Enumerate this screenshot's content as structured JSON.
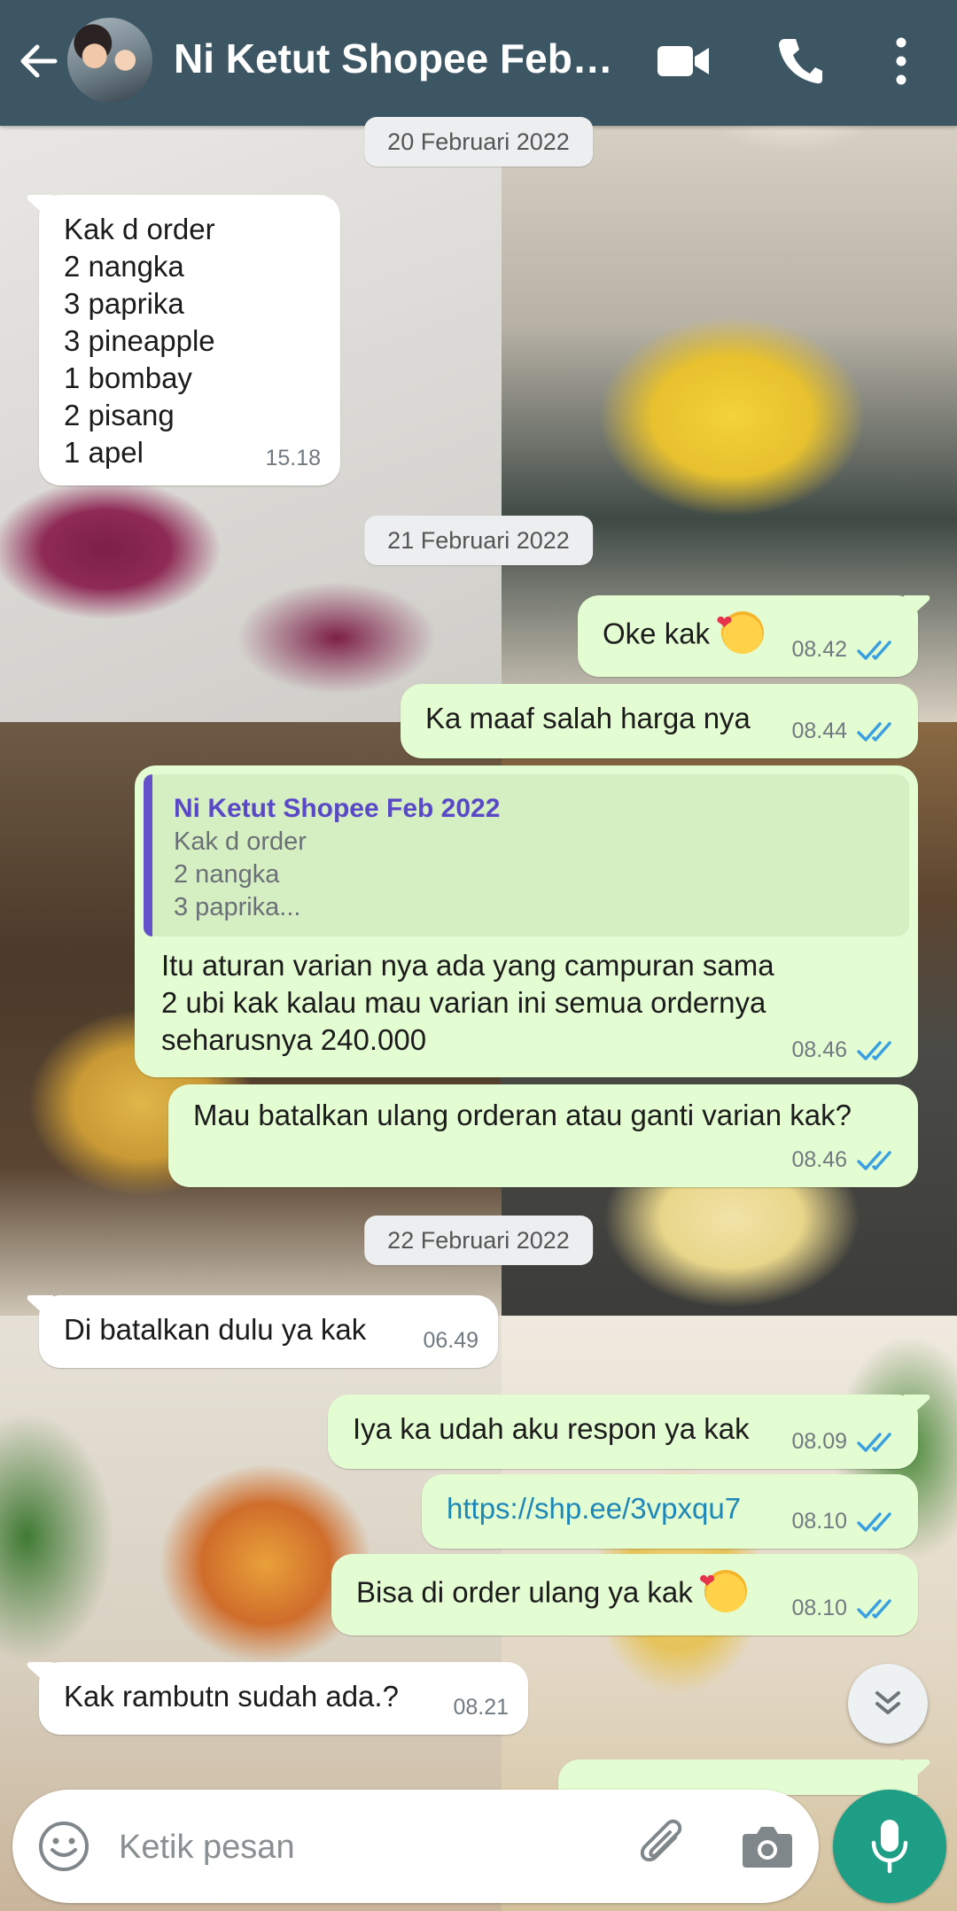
{
  "header": {
    "title": "Ni Ketut Shopee Feb…",
    "back_icon": "arrow-left-icon",
    "video_icon": "video-camera-icon",
    "call_icon": "phone-icon",
    "more_icon": "more-vertical-icon"
  },
  "dates": [
    "20 Februari 2022",
    "21 Februari 2022",
    "22 Februari 2022"
  ],
  "messages": [
    {
      "dir": "in",
      "text": "Kak d order\n2 nangka\n3 paprika\n3 pineapple\n1 bombay\n2 pisang\n1 apel",
      "time": "15.18"
    },
    {
      "dir": "out",
      "text": "Oke kak",
      "emoji": "smiling-face-with-hearts",
      "time": "08.42",
      "status": "read"
    },
    {
      "dir": "out",
      "text": "Ka maaf salah harga nya",
      "time": "08.44",
      "status": "read"
    },
    {
      "dir": "out",
      "quote": {
        "author": "Ni Ketut Shopee Feb 2022",
        "text": "Kak d order\n2 nangka\n3 paprika..."
      },
      "text": "Itu aturan varian nya ada yang campuran sama\n2 ubi kak kalau mau varian ini semua ordernya\nseharusnya 240.000",
      "time": "08.46",
      "status": "read"
    },
    {
      "dir": "out",
      "text": "Mau batalkan ulang orderan atau ganti varian kak?",
      "time": "08.46",
      "status": "read"
    },
    {
      "dir": "in",
      "text": "Di batalkan dulu ya kak",
      "time": "06.49"
    },
    {
      "dir": "out",
      "text": "Iya ka udah aku respon ya kak",
      "time": "08.09",
      "status": "read"
    },
    {
      "dir": "out",
      "text": "https://shp.ee/3vpxqu7",
      "link": true,
      "time": "08.10",
      "status": "read"
    },
    {
      "dir": "out",
      "text": "Bisa di order ulang ya kak",
      "emoji": "smiling-face-with-hearts",
      "time": "08.10",
      "status": "read"
    },
    {
      "dir": "in",
      "text": "Kak rambutn sudah ada.?",
      "time": "08.21"
    }
  ],
  "composer": {
    "placeholder": "Ketik pesan",
    "emoji_icon": "emoji-icon",
    "attach_icon": "paperclip-icon",
    "camera_icon": "camera-icon",
    "mic_icon": "microphone-icon"
  },
  "colors": {
    "header": "#3d5663",
    "outgoing_bubble": "#e4fcd2",
    "incoming_bubble": "#ffffff",
    "read_tick": "#3aa0e0",
    "mic_button": "#1f9e86",
    "quote_bar": "#6251c9"
  }
}
